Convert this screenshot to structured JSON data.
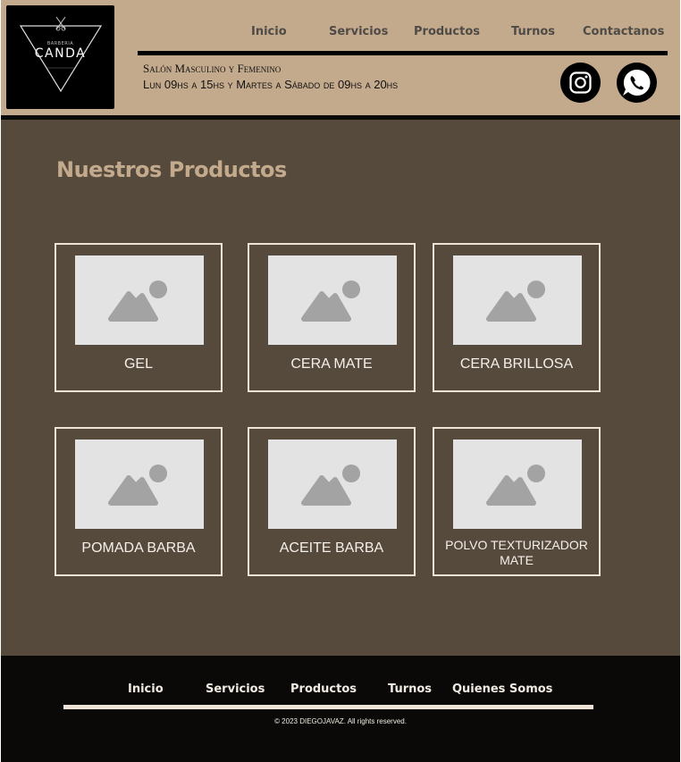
{
  "logo": {
    "small_text": "BARBERIA",
    "name": "CANDA"
  },
  "nav": {
    "items": [
      {
        "label": "Inicio"
      },
      {
        "label": "Servicios"
      },
      {
        "label": "Productos"
      },
      {
        "label": "Turnos"
      },
      {
        "label": "Contactanos"
      }
    ]
  },
  "schedule": {
    "line1": "Salón Masculino y Femenino",
    "line2": "Lun 09hs a 15hs y Martes a Sábado de 09hs a 20hs"
  },
  "social": {
    "instagram_icon": "instagram-icon",
    "whatsapp_icon": "whatsapp-icon"
  },
  "main": {
    "title": "Nuestros Productos",
    "products": [
      {
        "name": "GEL"
      },
      {
        "name": "CERA MATE"
      },
      {
        "name": "CERA BRILLOSA"
      },
      {
        "name": "POMADA BARBA"
      },
      {
        "name": "ACEITE BARBA"
      },
      {
        "name": "POLVO TEXTURIZADOR MATE"
      }
    ]
  },
  "footer": {
    "items": [
      {
        "label": "Inicio"
      },
      {
        "label": "Servicios"
      },
      {
        "label": "Productos"
      },
      {
        "label": "Turnos"
      },
      {
        "label": "Quienes Somos"
      }
    ],
    "copyright": "© 2023 DIEGOJAVAZ.  All rights reserved."
  },
  "colors": {
    "header_bg": "#c4aa8d",
    "main_bg": "#564a3c",
    "footer_bg": "#0a0908",
    "accent_title": "#c4aa8d",
    "card_border": "#eee3d6"
  }
}
